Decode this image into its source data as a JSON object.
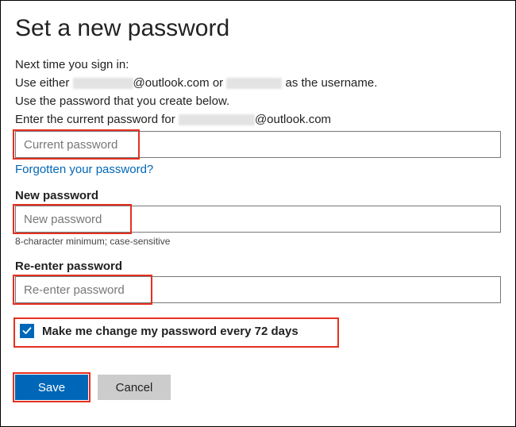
{
  "heading": "Set a new password",
  "instructions": {
    "line1": "Next time you sign in:",
    "line2_prefix": "Use either ",
    "line2_mid": "@outlook.com or ",
    "line2_suffix": " as the username.",
    "line3": "Use the password that you create below.",
    "line4_prefix": "Enter the current password for ",
    "line4_suffix": "@outlook.com"
  },
  "current_password": {
    "placeholder": "Current password",
    "value": ""
  },
  "forgot_link": "Forgotten your password?",
  "new_password": {
    "label": "New password",
    "placeholder": "New password",
    "value": "",
    "helper": "8-character minimum; case-sensitive"
  },
  "reenter_password": {
    "label": "Re-enter password",
    "placeholder": "Re-enter password",
    "value": ""
  },
  "force_change": {
    "checked": true,
    "label": "Make me change my password every 72 days"
  },
  "buttons": {
    "save": "Save",
    "cancel": "Cancel"
  }
}
